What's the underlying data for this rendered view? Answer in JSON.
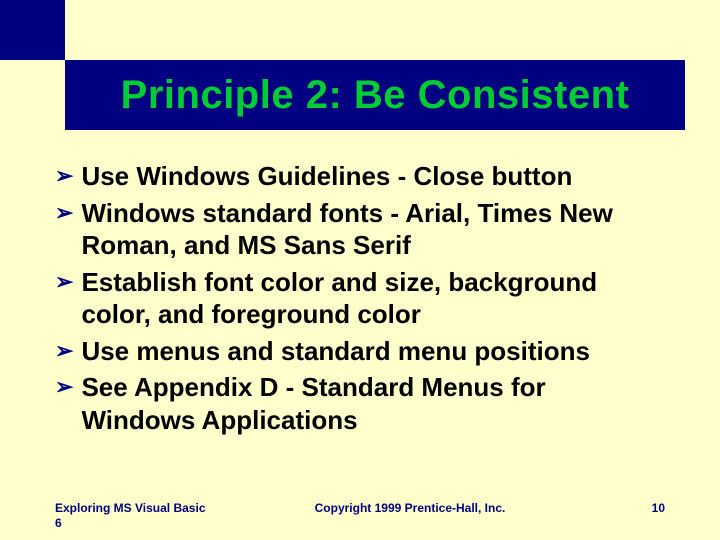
{
  "slide": {
    "title": "Principle 2: Be Consistent",
    "bullets": [
      "Use Windows Guidelines - Close button",
      "Windows standard fonts - Arial, Times New Roman, and MS Sans Serif",
      "Establish font color and size, background color, and foreground color",
      "Use menus and standard menu positions",
      "See Appendix D - Standard Menus for Windows Applications"
    ],
    "bullet_marker": "➢",
    "footer": {
      "left": "Exploring MS Visual Basic 6",
      "center": "Copyright 1999 Prentice-Hall, Inc.",
      "page_number": "10"
    }
  }
}
